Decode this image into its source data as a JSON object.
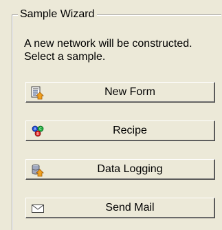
{
  "wizard": {
    "title": "Sample Wizard",
    "description": "A new network will be constructed. Select a sample."
  },
  "buttons": [
    {
      "label": "New Form",
      "icon": "new-form-icon"
    },
    {
      "label": "Recipe",
      "icon": "recipe-icon"
    },
    {
      "label": "Data Logging",
      "icon": "data-logging-icon"
    },
    {
      "label": "Send Mail",
      "icon": "envelope-icon"
    }
  ],
  "colors": {
    "background": "#ece9d8",
    "arrow_orange": "#f0a020",
    "recipe_blue": "#2050e0",
    "recipe_red": "#e02020",
    "recipe_green": "#20b040"
  }
}
